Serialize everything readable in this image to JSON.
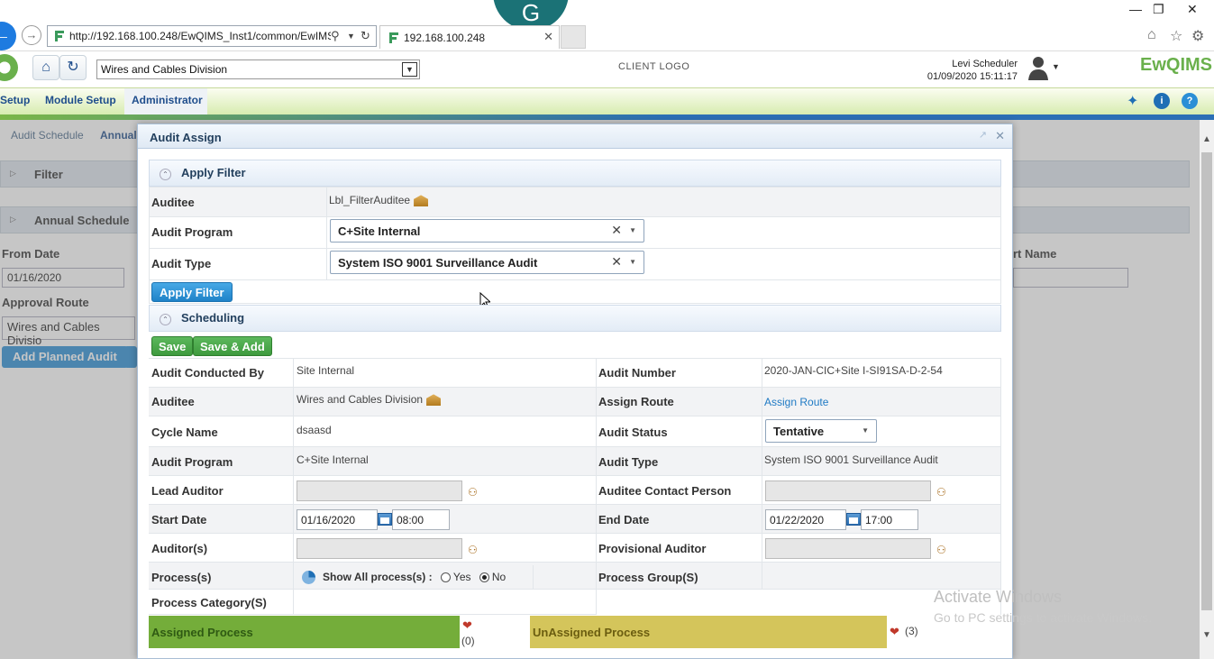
{
  "browser": {
    "url": "http://192.168.100.248/EwQIMS_Inst1/common/EwIMS",
    "tab_title": "192.168.100.248",
    "g_letter": "G"
  },
  "header": {
    "division": "Wires and Cables Division",
    "client_logo": "CLIENT LOGO",
    "user_name": "Levi Scheduler",
    "datetime": "01/09/2020 15:11:17",
    "brand": "EwQIMS"
  },
  "menu": {
    "items": [
      "Setup",
      "Module Setup",
      "Administrator"
    ]
  },
  "background_page": {
    "breadcrumb": [
      "Audit Schedule",
      "Annual"
    ],
    "filter_label": "Filter",
    "annual_label": "Annual Schedule",
    "from_date_label": "From Date",
    "from_date_value": "01/16/2020",
    "approval_route_label": "Approval Route",
    "approval_route_value": "Wires and Cables Divisio",
    "add_planned_button": "Add Planned Audit",
    "right_label": "rt Name"
  },
  "modal": {
    "title": "Audit Assign",
    "apply_filter": {
      "header": "Apply Filter",
      "auditee_label": "Auditee",
      "auditee_value": "Lbl_FilterAuditee",
      "program_label": "Audit Program",
      "program_value": "C+Site Internal",
      "type_label": "Audit Type",
      "type_value": "System ISO 9001 Surveillance Audit",
      "button": "Apply Filter"
    },
    "scheduling": {
      "header": "Scheduling",
      "save_button": "Save",
      "save_add_button": "Save & Add",
      "conducted_by_label": "Audit Conducted By",
      "conducted_by_value": "Site Internal",
      "audit_number_label": "Audit Number",
      "audit_number_value": "2020-JAN-CIC+Site I-SI91SA-D-2-54",
      "auditee_label": "Auditee",
      "auditee_value": "Wires and Cables Division",
      "assign_route_label": "Assign Route",
      "assign_route_link": "Assign Route",
      "cycle_label": "Cycle Name",
      "cycle_value": "dsaasd",
      "status_label": "Audit Status",
      "status_value": "Tentative",
      "program_label": "Audit Program",
      "program_value": "C+Site Internal",
      "type_label": "Audit Type",
      "type_value": "System ISO 9001 Surveillance Audit",
      "lead_auditor_label": "Lead Auditor",
      "contact_label": "Auditee Contact Person",
      "start_label": "Start Date",
      "start_date": "01/16/2020",
      "start_time": "08:00",
      "end_label": "End Date",
      "end_date": "01/22/2020",
      "end_time": "17:00",
      "auditors_label": "Auditor(s)",
      "prov_auditor_label": "Provisional Auditor",
      "process_label": "Process(s)",
      "show_all_label": "Show All process(s) :",
      "yes_label": "Yes",
      "no_label": "No",
      "process_group_label": "Process Group(S)",
      "process_category_label": "Process Category(S)",
      "assigned_label": "Assigned Process",
      "assigned_count": "(0)",
      "unassigned_label": "UnAssigned Process",
      "unassigned_count": "(3)"
    }
  },
  "watermark": {
    "line1": "Activate Windows",
    "line2": "Go to PC settings to activate Windows."
  }
}
